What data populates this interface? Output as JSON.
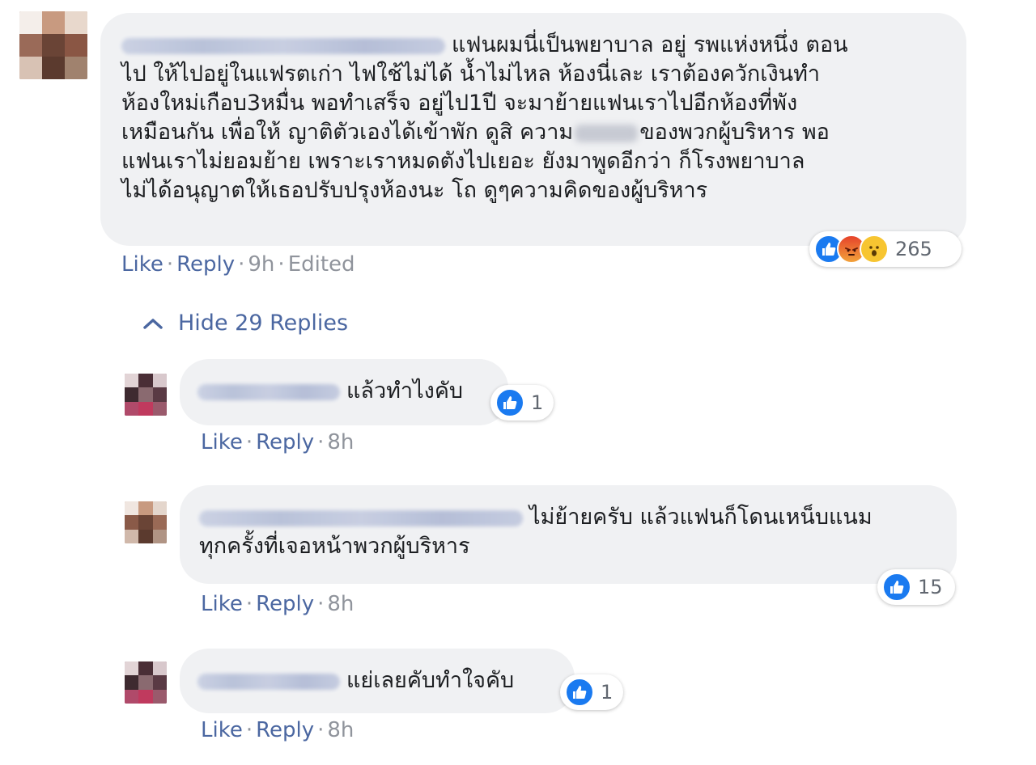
{
  "comments": {
    "main": {
      "text_lines": [
        "แฟนผมนี่เป็นพยาบาล อยู่ รพแห่งหนึ่ง ตอน",
        "ไป ให้ไปอยู่ในแฟรตเก่า ไฟใช้ไม่ได้ น้ำไม่ไหล ห้องนี่เละ เราต้องควักเงินทำ",
        "ห้องใหม่เกือบ3หมื่น พอทำเสร็จ อยู่ไป1ปี จะมาย้ายแฟนเราไปอีกห้องที่พัง",
        "เหมือนกัน เพื่อให้ ญาติตัวเองได้เข้าพัก ดูสิ ความ",
        "ของพวกผู้บริหาร พอ",
        "แฟนเราไม่ยอมย้าย เพราะเราหมดตังไปเยอะ ยังมาพูดอีกว่า ก็โรงพยาบาล",
        "ไม่ได้อนุญาตให้เธอปรับปรุงห้องนะ โถ ดูๆความคิดของผู้บริหาร"
      ],
      "like": "Like",
      "reply": "Reply",
      "time": "9h",
      "edited": "Edited",
      "reaction_count": "265",
      "reaction_icons": [
        "like-icon",
        "angry-icon",
        "wow-icon"
      ]
    },
    "hide_replies": "Hide 29 Replies",
    "replies": [
      {
        "text_lines": [
          "แล้วทำไงคับ"
        ],
        "like": "Like",
        "reply": "Reply",
        "time": "8h",
        "reaction_count": "1"
      },
      {
        "text_lines": [
          "ไม่ย้ายครับ แล้วแฟนก็โดนเหน็บแนม",
          "ทุกครั้งที่เจอหน้าพวกผู้บริหาร"
        ],
        "like": "Like",
        "reply": "Reply",
        "time": "8h",
        "reaction_count": "15"
      },
      {
        "text_lines": [
          "แย่เลยคับทำใจคับ"
        ],
        "like": "Like",
        "reply": "Reply",
        "time": "8h",
        "reaction_count": "1"
      }
    ]
  },
  "colors": {
    "bubble": "#f0f1f3",
    "link": "#4b67a1",
    "meta": "#90949c",
    "like_blue": "#1a7af0"
  }
}
